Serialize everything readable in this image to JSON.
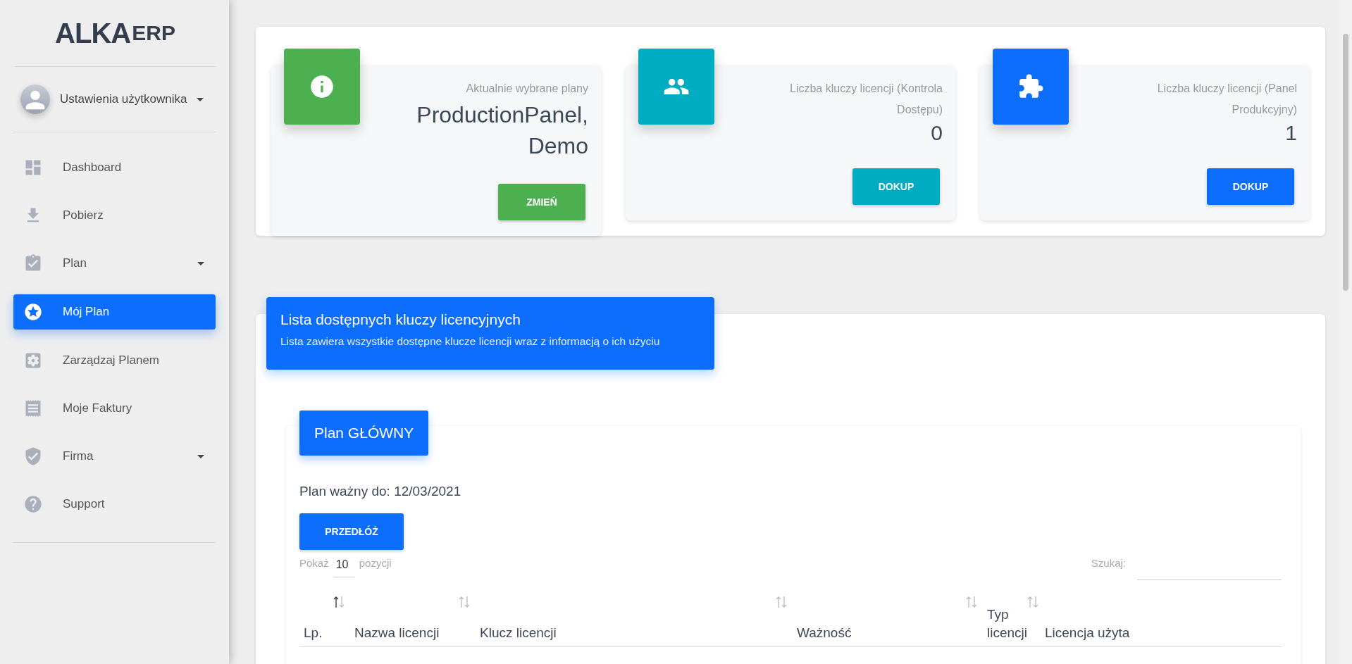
{
  "sidebar": {
    "logo": {
      "main": "ALKA",
      "suffix": "ERP"
    },
    "user": {
      "label": "Ustawienia użytkownika"
    },
    "items": [
      {
        "label": "Dashboard",
        "kind": "link",
        "selected": false
      },
      {
        "label": "Pobierz",
        "kind": "link",
        "selected": false
      },
      {
        "label": "Plan",
        "kind": "group",
        "selected": false
      },
      {
        "label": "Mój Plan",
        "kind": "link",
        "selected": true
      },
      {
        "label": "Zarządzaj Planem",
        "kind": "link",
        "selected": false
      },
      {
        "label": "Moje Faktury",
        "kind": "link",
        "selected": false
      },
      {
        "label": "Firma",
        "kind": "group",
        "selected": false
      },
      {
        "label": "Support",
        "kind": "link",
        "selected": false
      }
    ]
  },
  "stats": [
    {
      "color": "#4caf50",
      "title": "Aktualnie wybrane plany",
      "value": "ProductionPanel,Demo",
      "button": "ZMIEŃ"
    },
    {
      "color": "#00acc1",
      "title": "Liczba kluczy licencji (Kontrola Dostępu)",
      "value": "0",
      "button": "DOKUP"
    },
    {
      "color": "#0d6efd",
      "title": "Liczba kluczy licencji (Panel Produkcyjny)",
      "value": "1",
      "button": "DOKUP"
    }
  ],
  "licenses": {
    "title": "Lista dostępnych kluczy licencyjnych",
    "subtitle": "Lista zawiera wszystkie dostępne klucze licencji wraz z informacją o ich użyciu",
    "plan": {
      "title": "Plan GŁÓWNY",
      "valid_until": "Plan ważny do: 12/03/2021",
      "button": "PRZEDŁÓŻ",
      "show": {
        "before": "Pokaż",
        "value": "10",
        "after": "pozycji"
      },
      "search": {
        "label": "Szukaj:"
      },
      "columns": [
        {
          "label": "Lp.",
          "sorted": true
        },
        {
          "label": "Nazwa licencji",
          "sorted": false
        },
        {
          "label": "Klucz licencji",
          "sorted": false
        },
        {
          "label": "Ważność",
          "sorted": false
        },
        {
          "label": "Typ licencji",
          "sorted": false
        },
        {
          "label": "Licencja użyta"
        }
      ]
    }
  }
}
